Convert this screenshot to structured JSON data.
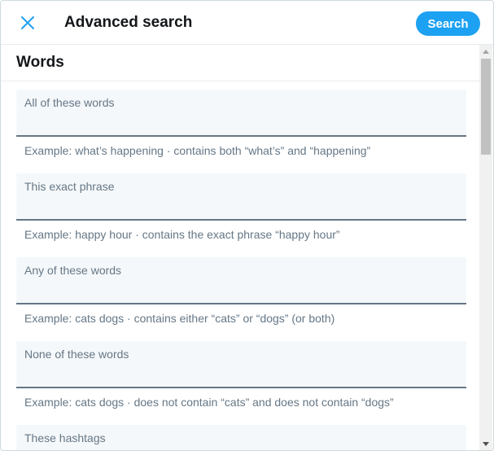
{
  "header": {
    "title": "Advanced search",
    "search_label": "Search",
    "close_icon": "close-icon"
  },
  "section": {
    "title": "Words"
  },
  "fields": [
    {
      "label": "All of these words",
      "example": "Example: what’s happening · contains both “what’s” and “happening”"
    },
    {
      "label": "This exact phrase",
      "example": "Example: happy hour · contains the exact phrase “happy hour”"
    },
    {
      "label": "Any of these words",
      "example": "Example: cats dogs · contains either “cats” or “dogs” (or both)"
    },
    {
      "label": "None of these words",
      "example": "Example: cats dogs · does not contain “cats” and does not contain “dogs”"
    },
    {
      "label": "These hashtags",
      "example": ""
    }
  ],
  "colors": {
    "accent": "#1da1f2",
    "field_bg": "#f5f8fa",
    "muted_text": "#657786"
  }
}
